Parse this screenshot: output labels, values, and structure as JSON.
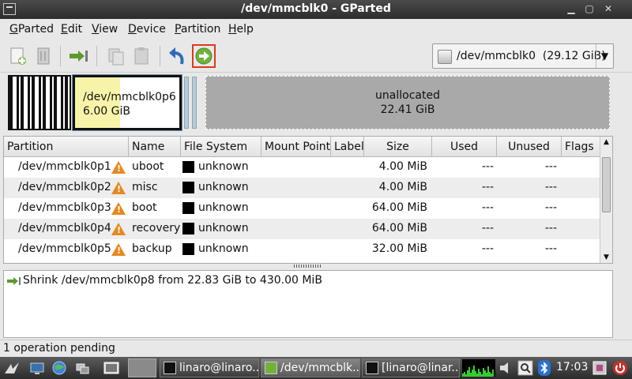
{
  "window": {
    "title": "/dev/mmcblk0 - GParted"
  },
  "menu": [
    "GParted",
    "Edit",
    "View",
    "Device",
    "Partition",
    "Help"
  ],
  "menu_mnemonics": [
    "G",
    "E",
    "V",
    "D",
    "P",
    "H"
  ],
  "device_selector": {
    "label": "/dev/mmcblk0",
    "size": "(29.12 GiB)"
  },
  "diskmap": {
    "selected_partition": {
      "name": "/dev/mmcblk0p6",
      "size": "6.00 GiB",
      "used_fraction": 0.43
    },
    "unallocated": {
      "label": "unallocated",
      "size": "22.41 GiB"
    }
  },
  "table": {
    "columns": [
      "Partition",
      "Name",
      "File System",
      "Mount Point",
      "Label",
      "Size",
      "Used",
      "Unused",
      "Flags"
    ],
    "rows": [
      {
        "partition": "/dev/mmcblk0p1",
        "name": "uboot",
        "fs": "unknown",
        "size": "4.00 MiB",
        "used": "---",
        "unused": "---"
      },
      {
        "partition": "/dev/mmcblk0p2",
        "name": "misc",
        "fs": "unknown",
        "size": "4.00 MiB",
        "used": "---",
        "unused": "---"
      },
      {
        "partition": "/dev/mmcblk0p3",
        "name": "boot",
        "fs": "unknown",
        "size": "64.00 MiB",
        "used": "---",
        "unused": "---"
      },
      {
        "partition": "/dev/mmcblk0p4",
        "name": "recovery",
        "fs": "unknown",
        "size": "64.00 MiB",
        "used": "---",
        "unused": "---"
      },
      {
        "partition": "/dev/mmcblk0p5",
        "name": "backup",
        "fs": "unknown",
        "size": "32.00 MiB",
        "used": "---",
        "unused": "---"
      }
    ]
  },
  "operations": [
    "Shrink /dev/mmcblk0p8 from 22.83 GiB to 430.00 MiB"
  ],
  "status": "1 operation pending",
  "taskbar": {
    "tasks": [
      "linaro@linaro...",
      "/dev/mmcblk...",
      "[linaro@linar..."
    ],
    "clock": "17:03"
  },
  "colors": {
    "accent_selected": "#e0381e",
    "used_space": "#f7f3a8",
    "warning": "#e8881e",
    "unallocated": "#a9a9a9"
  }
}
